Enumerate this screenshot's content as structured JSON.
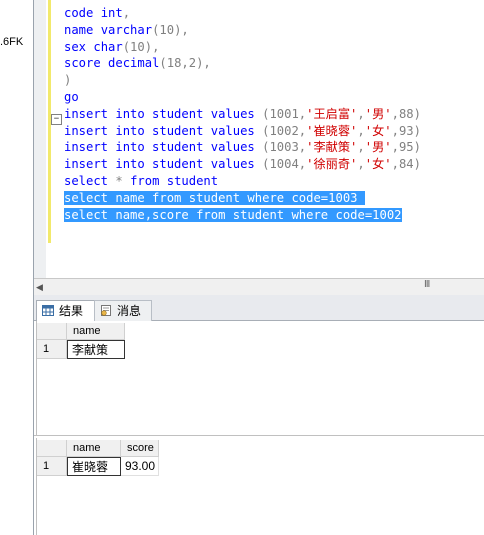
{
  "left_panel": {
    "label": ".6FK"
  },
  "editor": {
    "lines": [
      [
        {
          "t": "code ",
          "c": "kw"
        },
        {
          "t": "int",
          "c": "kw"
        },
        {
          "t": ",",
          "c": "gray"
        }
      ],
      [
        {
          "t": "name ",
          "c": "kw"
        },
        {
          "t": "varchar",
          "c": "kw"
        },
        {
          "t": "(10),",
          "c": "gray"
        }
      ],
      [
        {
          "t": "sex ",
          "c": "kw"
        },
        {
          "t": "char",
          "c": "kw"
        },
        {
          "t": "(10),",
          "c": "gray"
        }
      ],
      [
        {
          "t": "score ",
          "c": "kw"
        },
        {
          "t": "decimal",
          "c": "kw"
        },
        {
          "t": "(18,2),",
          "c": "gray"
        }
      ],
      [
        {
          "t": ")",
          "c": "gray"
        }
      ],
      [
        {
          "t": "go",
          "c": "kw"
        }
      ],
      [
        {
          "t": "insert into student values ",
          "c": "kw"
        },
        {
          "t": "(1001,",
          "c": "gray"
        },
        {
          "t": "'王启富'",
          "c": "str"
        },
        {
          "t": ",",
          "c": "gray"
        },
        {
          "t": "'男'",
          "c": "str"
        },
        {
          "t": ",88)",
          "c": "gray"
        }
      ],
      [
        {
          "t": "insert into student values ",
          "c": "kw"
        },
        {
          "t": "(1002,",
          "c": "gray"
        },
        {
          "t": "'崔晓蓉'",
          "c": "str"
        },
        {
          "t": ",",
          "c": "gray"
        },
        {
          "t": "'女'",
          "c": "str"
        },
        {
          "t": ",93)",
          "c": "gray"
        }
      ],
      [
        {
          "t": "insert into student values ",
          "c": "kw"
        },
        {
          "t": "(1003,",
          "c": "gray"
        },
        {
          "t": "'李献策'",
          "c": "str"
        },
        {
          "t": ",",
          "c": "gray"
        },
        {
          "t": "'男'",
          "c": "str"
        },
        {
          "t": ",95)",
          "c": "gray"
        }
      ],
      [
        {
          "t": "insert into student values ",
          "c": "kw"
        },
        {
          "t": "(1004,",
          "c": "gray"
        },
        {
          "t": "'徐丽奇'",
          "c": "str"
        },
        {
          "t": ",",
          "c": "gray"
        },
        {
          "t": "'女'",
          "c": "str"
        },
        {
          "t": ",84)",
          "c": "gray"
        }
      ],
      [
        {
          "t": "select ",
          "c": "kw"
        },
        {
          "t": "* ",
          "c": "gray"
        },
        {
          "t": "from ",
          "c": "kw"
        },
        {
          "t": "student",
          "c": "kw"
        }
      ],
      [
        {
          "t": "select name from student where code=1003 ",
          "c": "sel"
        }
      ],
      [
        {
          "t": "select name,score from student where code=1002",
          "c": "sel"
        }
      ]
    ],
    "top_fragment": "{ ( } ) ( ( ( …"
  },
  "scrollbar": {
    "grip": "III"
  },
  "tabs": {
    "results": "结果",
    "messages": "消息"
  },
  "grid1": {
    "columns": [
      "name"
    ],
    "rows": [
      [
        "1",
        "李献策"
      ]
    ]
  },
  "grid2": {
    "columns": [
      "name",
      "score"
    ],
    "rows": [
      [
        "1",
        "崔晓蓉",
        "93.00"
      ]
    ]
  },
  "colors": {
    "keyword": "#0000ff",
    "string": "#d00000",
    "selection": "#3399ff",
    "marker": "#f2e96b"
  }
}
